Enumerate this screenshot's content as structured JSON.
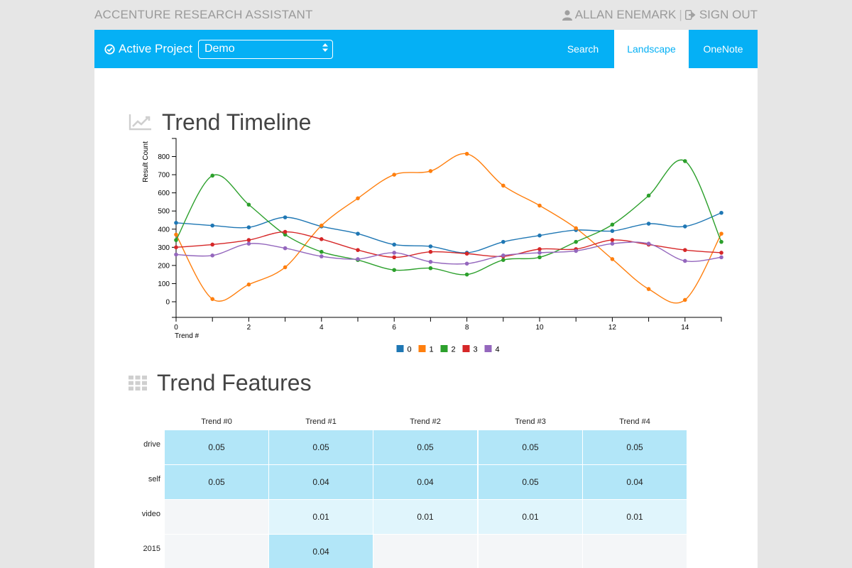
{
  "app": {
    "title": "ACCENTURE RESEARCH ASSISTANT"
  },
  "user": {
    "name": "ALLAN ENEMARK",
    "sign_out_label": "SIGN OUT",
    "user_icon": "user-icon",
    "sign_out_icon": "sign-out-icon"
  },
  "nav": {
    "active_project_label": "Active Project",
    "project_value": "Demo",
    "links": [
      {
        "label": "Search"
      },
      {
        "label": "Landscape"
      },
      {
        "label": "OneNote"
      }
    ],
    "active_link": "Landscape"
  },
  "colors": {
    "nav_bg": "#05b0f5",
    "accent": "#05b0f5",
    "cell_high": "#b2e6f8",
    "cell_low": "#e0f5fc",
    "cell_empty": "#f4f6f8"
  },
  "timeline": {
    "title": "Trend Timeline",
    "icon": "line-chart-icon"
  },
  "chart_data": {
    "type": "line",
    "xlabel": "Trend #",
    "ylabel": "Result Count",
    "x": [
      0,
      1,
      2,
      3,
      4,
      5,
      6,
      7,
      8,
      9,
      10,
      11,
      12,
      13,
      14,
      15
    ],
    "xlim": [
      0,
      15
    ],
    "ylim": [
      -50,
      900
    ],
    "xticks": [
      0,
      2,
      4,
      6,
      8,
      10,
      12,
      14
    ],
    "yticks": [
      0,
      100,
      200,
      300,
      400,
      500,
      600,
      700,
      800
    ],
    "legend_position": "bottom",
    "series": [
      {
        "name": "0",
        "color": "#1f77b4",
        "values": [
          435,
          420,
          410,
          465,
          415,
          375,
          315,
          305,
          270,
          330,
          365,
          395,
          390,
          430,
          415,
          490
        ]
      },
      {
        "name": "1",
        "color": "#ff7f0e",
        "values": [
          370,
          15,
          95,
          190,
          420,
          570,
          700,
          720,
          815,
          640,
          530,
          405,
          235,
          70,
          10,
          375
        ]
      },
      {
        "name": "2",
        "color": "#2ca02c",
        "values": [
          340,
          695,
          535,
          370,
          275,
          230,
          175,
          185,
          150,
          230,
          245,
          330,
          425,
          585,
          775,
          330
        ]
      },
      {
        "name": "3",
        "color": "#d62728",
        "values": [
          300,
          315,
          340,
          385,
          345,
          285,
          245,
          275,
          265,
          250,
          290,
          290,
          340,
          315,
          285,
          270
        ]
      },
      {
        "name": "4",
        "color": "#9467bd",
        "values": [
          260,
          255,
          320,
          295,
          250,
          235,
          270,
          220,
          210,
          255,
          270,
          280,
          320,
          320,
          225,
          245
        ]
      }
    ]
  },
  "features": {
    "title": "Trend Features",
    "icon": "grid-icon",
    "columns": [
      "Trend #0",
      "Trend #1",
      "Trend #2",
      "Trend #3",
      "Trend #4"
    ],
    "rows": [
      {
        "label": "drive",
        "cells": [
          "0.05",
          "0.05",
          "0.05",
          "0.05",
          "0.05"
        ]
      },
      {
        "label": "self",
        "cells": [
          "0.05",
          "0.04",
          "0.04",
          "0.05",
          "0.04"
        ]
      },
      {
        "label": "video",
        "cells": [
          "",
          "0.01",
          "0.01",
          "0.01",
          "0.01"
        ]
      },
      {
        "label": "2015",
        "cells": [
          "",
          "0.04",
          "",
          "",
          ""
        ]
      }
    ]
  }
}
